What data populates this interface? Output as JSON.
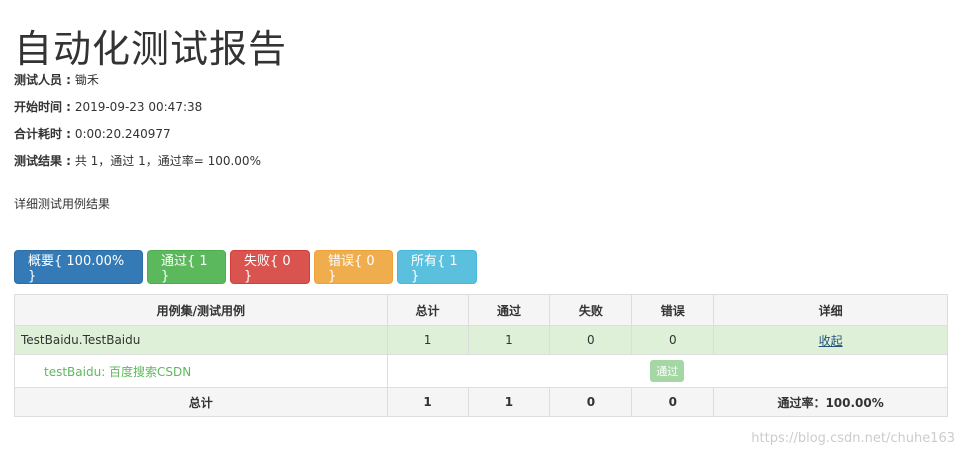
{
  "report": {
    "title": "自动化测试报告",
    "tester_label": "测试人员 :",
    "tester": "锄禾",
    "start_label": "开始时间 :",
    "start": "2019-09-23 00:47:38",
    "duration_label": "合计耗时 :",
    "duration": "0:00:20.240977",
    "result_label": "测试结果 :",
    "result": "共 1，通过 1，通过率= 100.00%",
    "detail_note": "详细测试用例结果"
  },
  "filters": {
    "summary": "概要{ 100.00% }",
    "pass": "通过{ 1 }",
    "fail": "失败{ 0 }",
    "error": "错误{ 0 }",
    "all": "所有{ 1 }"
  },
  "table": {
    "headers": [
      "用例集/测试用例",
      "总计",
      "通过",
      "失败",
      "错误",
      "详细"
    ],
    "suite": {
      "name": "TestBaidu.TestBaidu",
      "total": "1",
      "pass": "1",
      "fail": "0",
      "error": "0",
      "detail": "收起"
    },
    "case": {
      "name": "testBaidu: 百度搜索CSDN",
      "status": "通过"
    },
    "total_row": {
      "label": "总计",
      "total": "1",
      "pass": "1",
      "fail": "0",
      "error": "0",
      "rate": "通过率：100.00%"
    }
  },
  "watermark": "https://blog.csdn.net/chuhe163",
  "colors": {
    "primary": "#337ab7",
    "success": "#5cb85c",
    "danger": "#d9534f",
    "warning": "#f0ad4e",
    "info": "#5bc0de",
    "suite_row": "#dff0d8"
  }
}
